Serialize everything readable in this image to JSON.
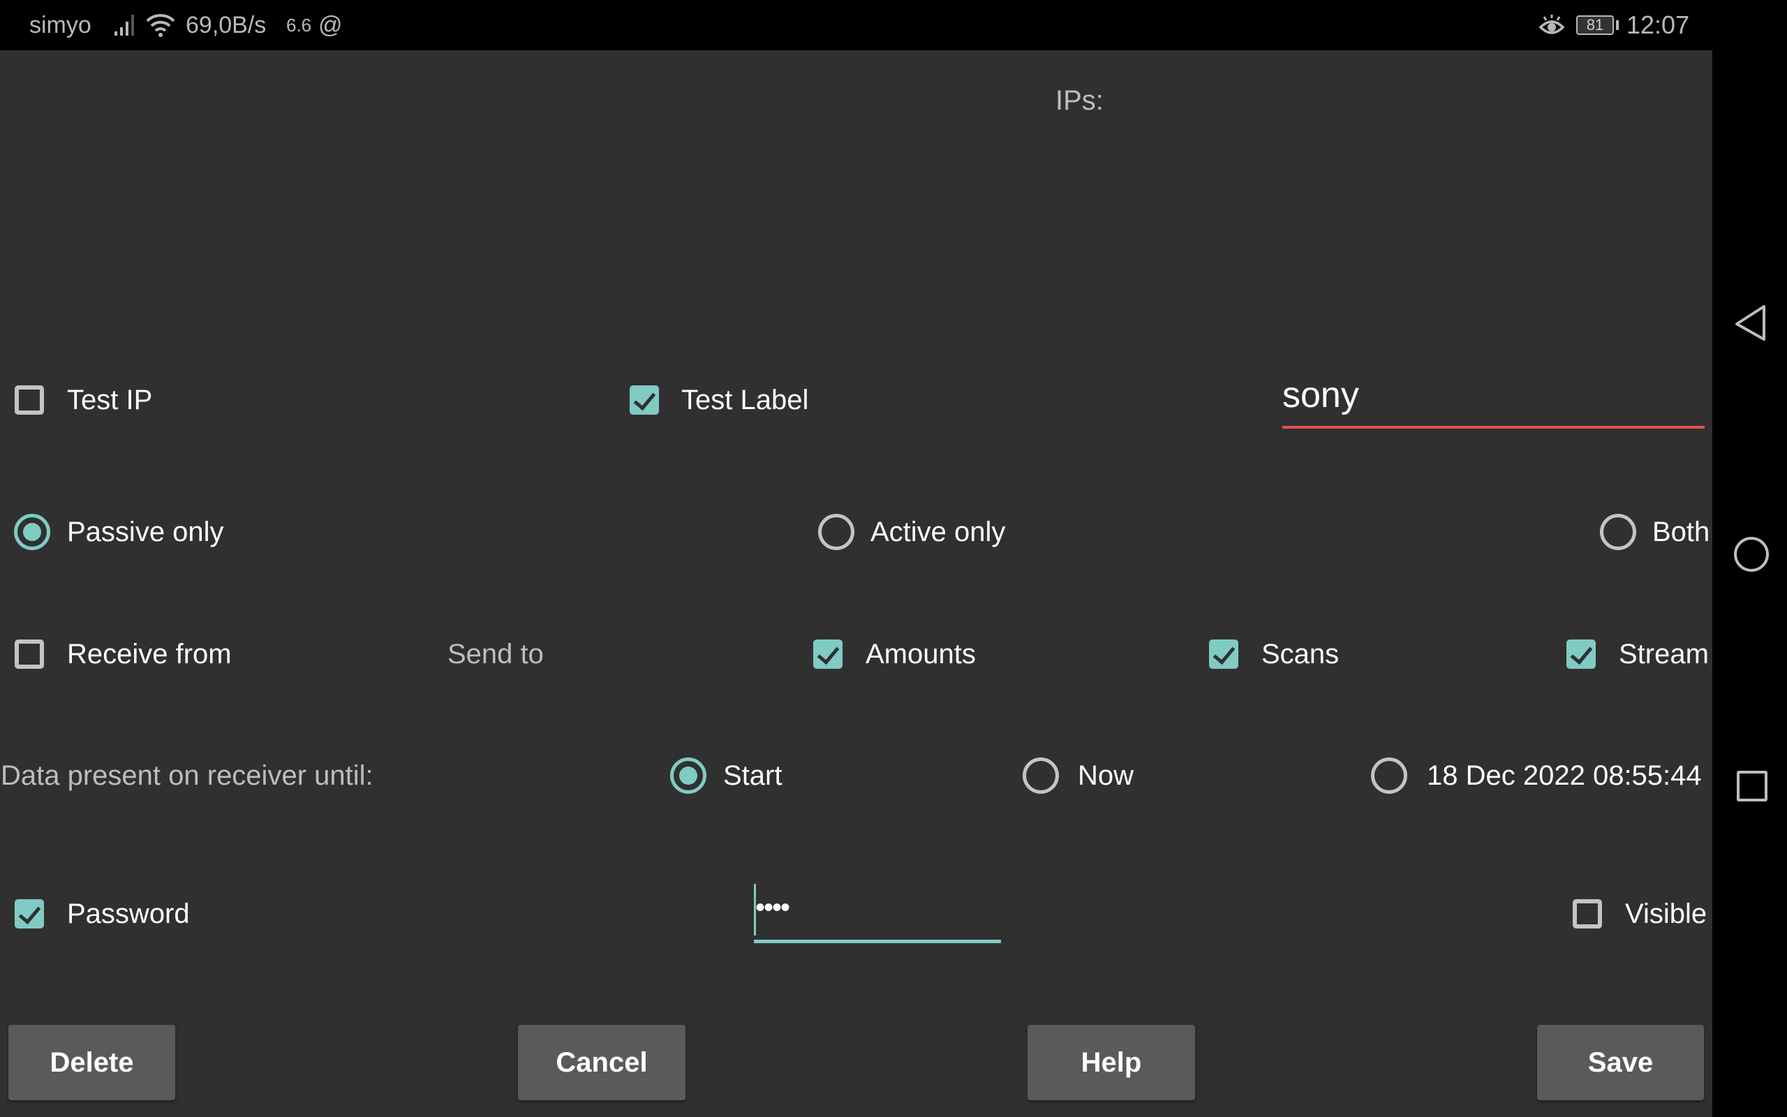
{
  "status_bar": {
    "carrier": "simyo",
    "net_speed": "69,0B/s",
    "network_type": "6.6",
    "extra_icon": "@",
    "battery_level": "81",
    "time": "12:07",
    "icons": [
      "signal-icon",
      "wifi-icon",
      "at-icon",
      "eye-icon",
      "battery-icon"
    ]
  },
  "form": {
    "ips_label": "IPs:",
    "test_ip": {
      "label": "Test IP",
      "checked": false
    },
    "test_label": {
      "label": "Test Label",
      "checked": true
    },
    "label_input_value": "sony",
    "mode_options": [
      {
        "label": "Passive only",
        "selected": true
      },
      {
        "label": "Active only",
        "selected": false
      },
      {
        "label": "Both",
        "selected": false
      }
    ],
    "receive_from": {
      "label": "Receive from",
      "checked": false
    },
    "send_to_label": "Send to",
    "send_options": [
      {
        "label": "Amounts",
        "checked": true
      },
      {
        "label": "Scans",
        "checked": true
      },
      {
        "label": "Stream",
        "checked": true
      }
    ],
    "data_until_label": "Data present on receiver until:",
    "until_options": [
      {
        "label": "Start",
        "selected": true
      },
      {
        "label": "Now",
        "selected": false
      },
      {
        "label": "18 Dec 2022 08:55:44",
        "selected": false
      }
    ],
    "password": {
      "label": "Password",
      "checked": true
    },
    "password_value": "••••",
    "visible": {
      "label": "Visible",
      "checked": false
    }
  },
  "buttons": {
    "delete": "Delete",
    "cancel": "Cancel",
    "help": "Help",
    "save": "Save"
  },
  "colors": {
    "accent": "#80cbc4",
    "error_underline": "#e05252",
    "background": "#303030",
    "button": "#5a5a5b"
  },
  "nav_bar": {
    "icons": [
      "back-icon",
      "home-icon",
      "recents-icon"
    ]
  }
}
